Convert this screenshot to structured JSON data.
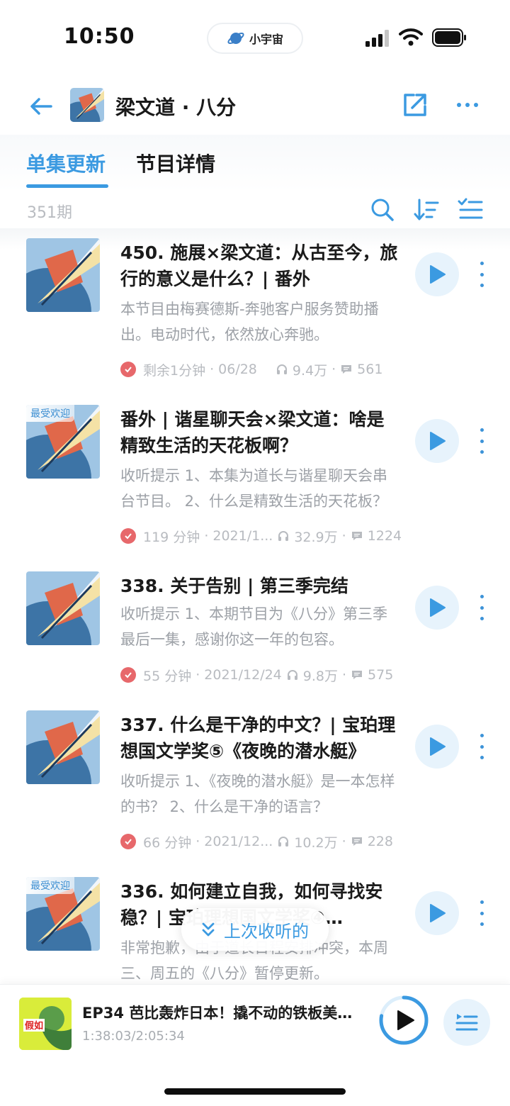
{
  "status_bar": {
    "time": "10:50",
    "brand": "小宇宙",
    "icons": [
      "signal-icon",
      "wifi-icon",
      "battery-icon"
    ]
  },
  "header": {
    "title": "梁文道 · 八分",
    "icons": [
      "back-arrow-icon",
      "share-icon",
      "more-icon"
    ]
  },
  "tabs": [
    {
      "label": "单集更新",
      "active": true
    },
    {
      "label": "节目详情",
      "active": false
    }
  ],
  "toolbar": {
    "episode_count": "351期",
    "icons": [
      "search-icon",
      "sort-icon",
      "multi-select-icon"
    ]
  },
  "episodes": [
    {
      "title": "450. 施展×梁文道：从古至今，旅行的意义是什么？| 番外",
      "description": "本节目由梅赛德斯-奔驰客户服务赞助播出。电动时代，依然放心奔驰。",
      "badge": "",
      "duration": "剩余1分钟",
      "date": "06/28",
      "plays": "9.4万",
      "comments": "561"
    },
    {
      "title": "番外 | 谐星聊天会×梁文道：啥是精致生活的天花板啊？",
      "description": "收听提示 1、本集为道长与谐星聊天会串台节目。 2、什么是精致生活的天花板？",
      "badge": "最受欢迎",
      "duration": "119 分钟",
      "date": "2021/1...",
      "plays": "32.9万",
      "comments": "1224"
    },
    {
      "title": "338. 关于告别 | 第三季完结",
      "description": "收听提示 1、本期节目为《八分》第三季最后一集，感谢你这一年的包容。",
      "badge": "",
      "duration": "55 分钟",
      "date": "2021/12/24",
      "plays": "9.8万",
      "comments": "575"
    },
    {
      "title": "337. 什么是干净的中文？| 宝珀理想国文学奖⑤《夜晚的潜水艇》",
      "description": "收听提示 1、《夜晚的潜水艇》是一本怎样的书？ 2、什么是干净的语言？",
      "badge": "",
      "duration": "66 分钟",
      "date": "2021/12...",
      "plays": "10.2万",
      "comments": "228"
    },
    {
      "title": "336. 如何建立自我，如何寻找安稳？| 宝珀理想国文学奖④…",
      "description": "非常抱歉，由于道长日程安排冲突，本周三、周五的《八分》暂停更新。",
      "badge": "最受欢迎",
      "duration": "",
      "date": "",
      "plays": "",
      "comments": ""
    }
  ],
  "resume_pill": {
    "label": "上次收听的"
  },
  "now_playing": {
    "title": "EP34 芭比轰炸日本！撬不动的铁板美国人",
    "progress": "1:38:03/2:05:34",
    "progress_fraction": 0.78,
    "cover_text": "假如",
    "colors": {
      "accent": "#3b9ae1",
      "ring_track": "#dceefb"
    }
  },
  "colors": {
    "accent": "#3b9ae1",
    "listened_check": "#e7686b",
    "play_bg": "#e7f3fc"
  }
}
